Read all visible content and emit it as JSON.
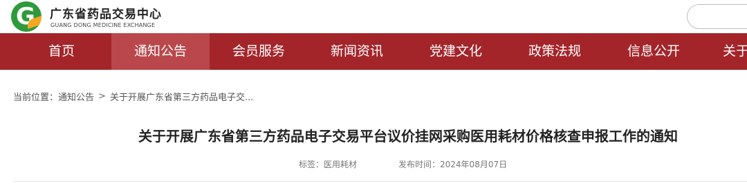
{
  "site": {
    "name_cn": "广东省药品交易中心",
    "name_en": "GUANG DONG MEDICINE EXCHANGE",
    "logo_letter": "G",
    "brand_color": "#a3252a",
    "logo_color": "#2e9a3c"
  },
  "nav": {
    "items": [
      {
        "label": "首页",
        "active": false
      },
      {
        "label": "通知公告",
        "active": true
      },
      {
        "label": "会员服务",
        "active": false
      },
      {
        "label": "新闻资讯",
        "active": false
      },
      {
        "label": "党建文化",
        "active": false
      },
      {
        "label": "政策法规",
        "active": false
      },
      {
        "label": "信息公开",
        "active": false
      },
      {
        "label": "关于",
        "active": false
      }
    ]
  },
  "breadcrumb": {
    "prefix": "当前位置：",
    "section": "通知公告",
    "separator": ">",
    "current": "关于开展广东省第三方药品电子交..."
  },
  "article": {
    "title": "关于开展广东省第三方药品电子交易平台议价挂网采购医用耗材价格核查申报工作的通知",
    "tag_label": "标签：",
    "tag_value": "医用耗材",
    "date_label": "发布时间：",
    "date_value": "2024年08月07日"
  }
}
